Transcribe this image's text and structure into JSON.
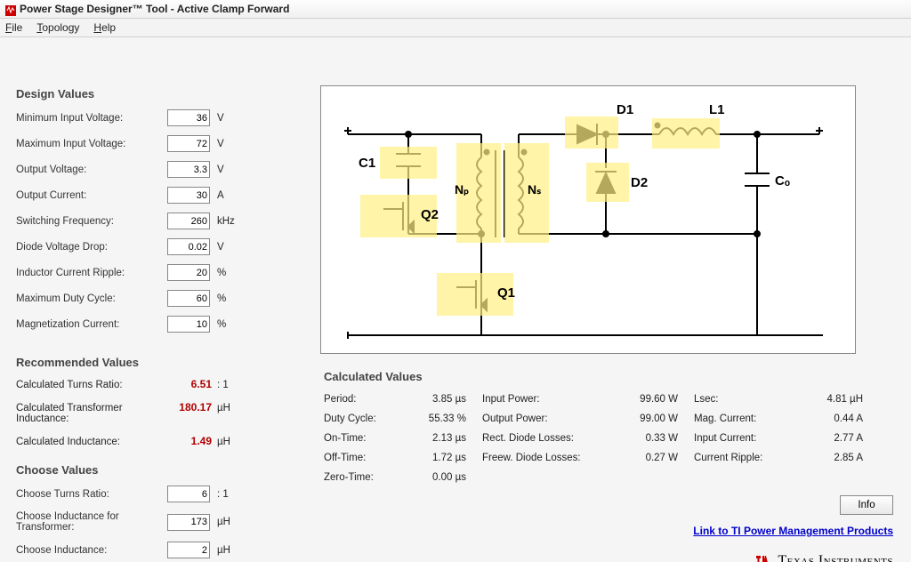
{
  "window": {
    "title": "Power Stage Designer™ Tool - Active Clamp Forward"
  },
  "menu": {
    "file": "File",
    "topology": "Topology",
    "help": "Help"
  },
  "design_values": {
    "title": "Design Values",
    "rows": [
      {
        "label": "Minimum Input Voltage:",
        "value": "36",
        "unit": "V"
      },
      {
        "label": "Maximum Input Voltage:",
        "value": "72",
        "unit": "V"
      },
      {
        "label": "Output Voltage:",
        "value": "3.3",
        "unit": "V"
      },
      {
        "label": "Output Current:",
        "value": "30",
        "unit": "A"
      },
      {
        "label": "Switching Frequency:",
        "value": "260",
        "unit": "kHz"
      },
      {
        "label": "Diode Voltage Drop:",
        "value": "0.02",
        "unit": "V"
      },
      {
        "label": "Inductor Current Ripple:",
        "value": "20",
        "unit": "%"
      },
      {
        "label": "Maximum Duty Cycle:",
        "value": "60",
        "unit": "%"
      },
      {
        "label": "Magnetization Current:",
        "value": "10",
        "unit": "%"
      }
    ]
  },
  "recommended": {
    "title": "Recommended Values",
    "rows": [
      {
        "label": "Calculated Turns Ratio:",
        "value": "6.51",
        "suffix": ": 1"
      },
      {
        "label": "Calculated Transformer Inductance:",
        "value": "180.17",
        "suffix": "µH"
      },
      {
        "label": "Calculated Inductance:",
        "value": "1.49",
        "suffix": "µH"
      }
    ]
  },
  "choose": {
    "title": "Choose Values",
    "rows": [
      {
        "label": "Choose Turns Ratio:",
        "value": "6",
        "unit": ": 1"
      },
      {
        "label": "Choose Inductance for Transformer:",
        "value": "173",
        "unit": "µH"
      },
      {
        "label": "Choose Inductance:",
        "value": "2",
        "unit": "µH"
      }
    ]
  },
  "calculated": {
    "title": "Calculated Values",
    "col1": [
      {
        "label": "Period:",
        "value": "3.85 µs"
      },
      {
        "label": "Duty Cycle:",
        "value": "55.33 %"
      },
      {
        "label": "On-Time:",
        "value": "2.13 µs"
      },
      {
        "label": "Off-Time:",
        "value": "1.72 µs"
      },
      {
        "label": "Zero-Time:",
        "value": "0.00 µs"
      }
    ],
    "col2": [
      {
        "label": "Input Power:",
        "value": "99.60  W"
      },
      {
        "label": "Output Power:",
        "value": "99.00  W"
      },
      {
        "label": "Rect. Diode Losses:",
        "value": "0.33  W"
      },
      {
        "label": "Freew. Diode Losses:",
        "value": "0.27  W"
      }
    ],
    "col3": [
      {
        "label": "Lsec:",
        "value": "4.81 µH"
      },
      {
        "label": "Mag. Current:",
        "value": "0.44  A"
      },
      {
        "label": "Input Current:",
        "value": "2.77  A"
      },
      {
        "label": "Current Ripple:",
        "value": "2.85  A"
      }
    ]
  },
  "schematic": {
    "components": {
      "C1": "C1",
      "Q1": "Q1",
      "Q2": "Q2",
      "NP": "Nₚ",
      "NS": "Nₛ",
      "D1": "D1",
      "D2": "D2",
      "L1": "L1",
      "CO": "Cₒ"
    }
  },
  "buttons": {
    "info": "Info"
  },
  "links": {
    "ti_pm": "Link to TI Power Management Products"
  },
  "brand": {
    "ti": "Texas Instruments"
  }
}
